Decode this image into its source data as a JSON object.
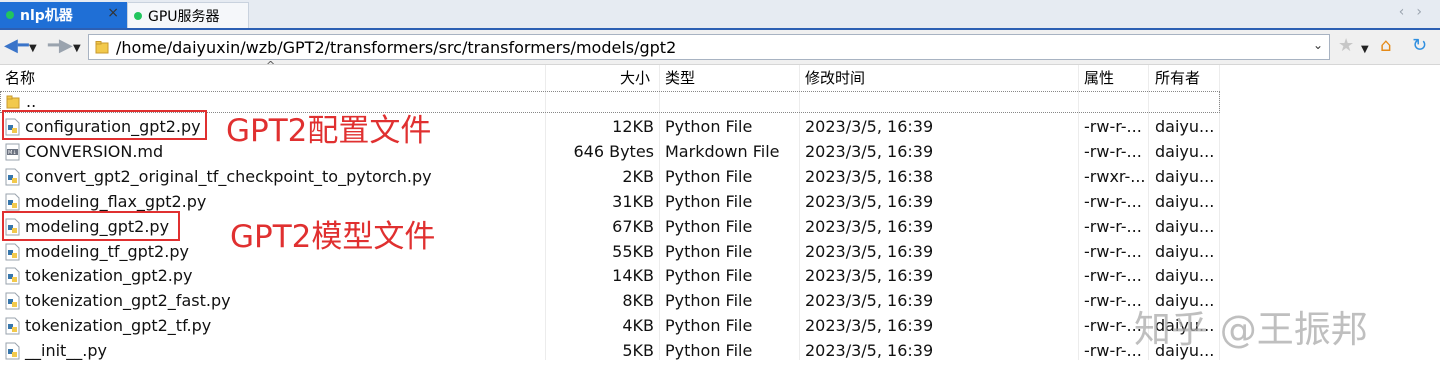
{
  "tabs": [
    {
      "label": "nlp机器",
      "close": "×"
    },
    {
      "label": "GPU服务器"
    }
  ],
  "toolbar": {
    "path": "/home/daiyuxin/wzb/GPT2/transformers/src/transformers/models/gpt2"
  },
  "columns": {
    "name": "名称",
    "size": "大小",
    "type": "类型",
    "modified": "修改时间",
    "perm": "属性",
    "owner": "所有者"
  },
  "parent_row": {
    "name": ".."
  },
  "files": [
    {
      "name": "configuration_gpt2.py",
      "size": "12KB",
      "type": "Python File",
      "modified": "2023/3/5, 16:39",
      "perm": "-rw-r-...",
      "owner": "daiyu...",
      "icon": "python-file-icon"
    },
    {
      "name": "CONVERSION.md",
      "size": "646 Bytes",
      "type": "Markdown File",
      "modified": "2023/3/5, 16:39",
      "perm": "-rw-r-...",
      "owner": "daiyu...",
      "icon": "markdown-file-icon"
    },
    {
      "name": "convert_gpt2_original_tf_checkpoint_to_pytorch.py",
      "size": "2KB",
      "type": "Python File",
      "modified": "2023/3/5, 16:38",
      "perm": "-rwxr-...",
      "owner": "daiyu...",
      "icon": "python-file-icon"
    },
    {
      "name": "modeling_flax_gpt2.py",
      "size": "31KB",
      "type": "Python File",
      "modified": "2023/3/5, 16:39",
      "perm": "-rw-r-...",
      "owner": "daiyu...",
      "icon": "python-file-icon"
    },
    {
      "name": "modeling_gpt2.py",
      "size": "67KB",
      "type": "Python File",
      "modified": "2023/3/5, 16:39",
      "perm": "-rw-r-...",
      "owner": "daiyu...",
      "icon": "python-file-icon"
    },
    {
      "name": "modeling_tf_gpt2.py",
      "size": "55KB",
      "type": "Python File",
      "modified": "2023/3/5, 16:39",
      "perm": "-rw-r-...",
      "owner": "daiyu...",
      "icon": "python-file-icon"
    },
    {
      "name": "tokenization_gpt2.py",
      "size": "14KB",
      "type": "Python File",
      "modified": "2023/3/5, 16:39",
      "perm": "-rw-r-...",
      "owner": "daiyu...",
      "icon": "python-file-icon"
    },
    {
      "name": "tokenization_gpt2_fast.py",
      "size": "8KB",
      "type": "Python File",
      "modified": "2023/3/5, 16:39",
      "perm": "-rw-r-...",
      "owner": "daiyu...",
      "icon": "python-file-icon"
    },
    {
      "name": "tokenization_gpt2_tf.py",
      "size": "4KB",
      "type": "Python File",
      "modified": "2023/3/5, 16:39",
      "perm": "-rw-r-...",
      "owner": "daiyu...",
      "icon": "python-file-icon"
    },
    {
      "name": "__init__.py",
      "size": "5KB",
      "type": "Python File",
      "modified": "2023/3/5, 16:39",
      "perm": "-rw-r-...",
      "owner": "daiyu...",
      "icon": "python-file-icon"
    }
  ],
  "annotations": [
    {
      "text": "GPT2配置文件"
    },
    {
      "text": "GPT2模型文件"
    }
  ],
  "watermark": "知乎 @王振邦",
  "colors": {
    "accent": "#1f6fd6",
    "annotation": "#e03030",
    "status_dot": "#22c55e"
  }
}
